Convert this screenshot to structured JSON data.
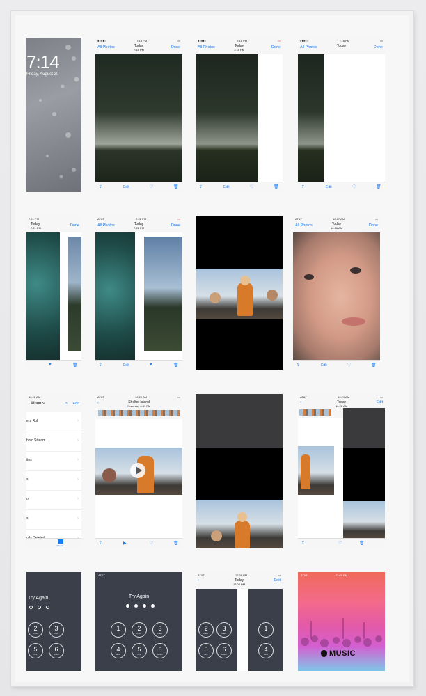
{
  "frame_alt": "Framed print: grid of iPhone screenshots",
  "lock": {
    "time": "7:14",
    "date": "Friday, August 30"
  },
  "shots": {
    "s2": {
      "time": "7:18 PM",
      "left": "All Photos",
      "title": "Today",
      "sub": "7:18 PM",
      "right": "Done",
      "edit": "Edit"
    },
    "s3": {
      "time": "7:18 PM",
      "left": "All Photos",
      "title": "Today",
      "sub": "7:18 PM",
      "right": "Done",
      "edit": "Edit"
    },
    "s4": {
      "time": "7:18 PM",
      "left": "All Photos",
      "title": "Today",
      "sub": "",
      "right": "Done",
      "edit": "Edit"
    },
    "s5": {
      "time": "7:21 PM",
      "title": "Today",
      "sub": "7:21 PM",
      "right": "Done"
    },
    "s6": {
      "carrier": "AT&T",
      "time": "7:22 PM",
      "left": "All Photos",
      "title": "Today",
      "sub": "7:22 PM",
      "right": "Done",
      "edit": "Edit"
    },
    "s8": {
      "carrier": "AT&T",
      "time": "10:07 AM",
      "left": "All Photos",
      "title": "Today",
      "sub": "10:06 AM",
      "right": "Done",
      "edit": "Edit"
    },
    "s9": {
      "time": "10:28 AM",
      "title": "Albums",
      "right": "Edit",
      "tab": "Albums",
      "rows": [
        "era Roll",
        "hoto Stream",
        "ites",
        "s",
        "o",
        "s",
        "ntly Deleted"
      ]
    },
    "s10": {
      "carrier": "AT&T",
      "time": "10:29 AM",
      "title": "Shelter Island",
      "sub": "Yesterday 6:31 PM"
    },
    "s12": {
      "carrier": "AT&T",
      "time": "10:29 AM",
      "title": "Today",
      "sub": "10:28 AM",
      "right": "Edit"
    },
    "s13": {
      "title": "Try Again"
    },
    "s14": {
      "carrier": "AT&T",
      "title": "Try Again"
    },
    "s15": {
      "carrier": "AT&T",
      "time": "12:06 PM",
      "title": "Today",
      "sub": "12:04 PM",
      "right": "Edit"
    },
    "s16": {
      "carrier": "AT&T",
      "time": "12:08 PM",
      "music": "MUSIC"
    }
  },
  "keypad": [
    {
      "n": "1",
      "l": ""
    },
    {
      "n": "2",
      "l": "ABC"
    },
    {
      "n": "3",
      "l": "DEF"
    },
    {
      "n": "4",
      "l": "GHI"
    },
    {
      "n": "5",
      "l": "JKL"
    },
    {
      "n": "6",
      "l": "MNO"
    }
  ],
  "colors": {
    "ios_blue": "#1a7cf2",
    "lock_bg": "#3a3f4a",
    "toolbar": "#f6f6f7"
  },
  "icons": [
    "share-icon",
    "heart-icon",
    "trash-icon",
    "play-icon",
    "back-chevron-icon",
    "search-icon",
    "apple-logo-icon"
  ]
}
